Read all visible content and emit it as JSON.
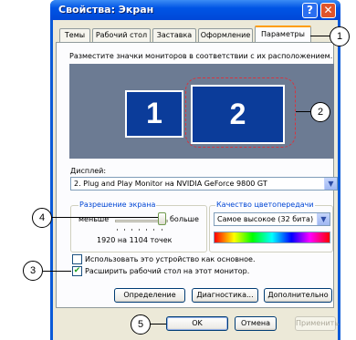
{
  "window": {
    "title": "Свойства: Экран"
  },
  "title_buttons": {
    "help": "?",
    "close": "✕"
  },
  "tabs": [
    {
      "label": "Темы"
    },
    {
      "label": "Рабочий стол"
    },
    {
      "label": "Заставка"
    },
    {
      "label": "Оформление"
    },
    {
      "label": "Параметры"
    }
  ],
  "monitors": {
    "instruction": "Разместите значки мониторов в соответствии с их расположением.",
    "m1": "1",
    "m2": "2"
  },
  "display": {
    "label": "Дисплей:",
    "value": "2. Plug and Play Monitor на NVIDIA GeForce 9800 GT",
    "dropdown_icon": "chevron-down-icon"
  },
  "resolution": {
    "label": "Разрешение экрана",
    "less": "меньше",
    "more": "больше",
    "value": "1920 на 1104 точек"
  },
  "color_quality": {
    "label": "Качество цветопередачи",
    "value": "Самое высокое (32 бита)"
  },
  "checks": {
    "primary": {
      "label": "Использовать это устройство как основное.",
      "checked": false
    },
    "extend": {
      "label": "Расширить рабочий стол на этот монитор.",
      "checked": true
    }
  },
  "panel_buttons": {
    "identify": "Определение",
    "troubleshoot": "Диагностика...",
    "advanced": "Дополнительно"
  },
  "dialog_buttons": {
    "ok": "OK",
    "cancel": "Отмена",
    "apply": "Применить"
  },
  "callouts": [
    "1",
    "2",
    "3",
    "4",
    "5"
  ],
  "colors": {
    "titlebar": "#0055e5",
    "monitor_bg": "#6c7b93",
    "monitor": "#0b3c9a",
    "highlight": "#d8333f"
  }
}
